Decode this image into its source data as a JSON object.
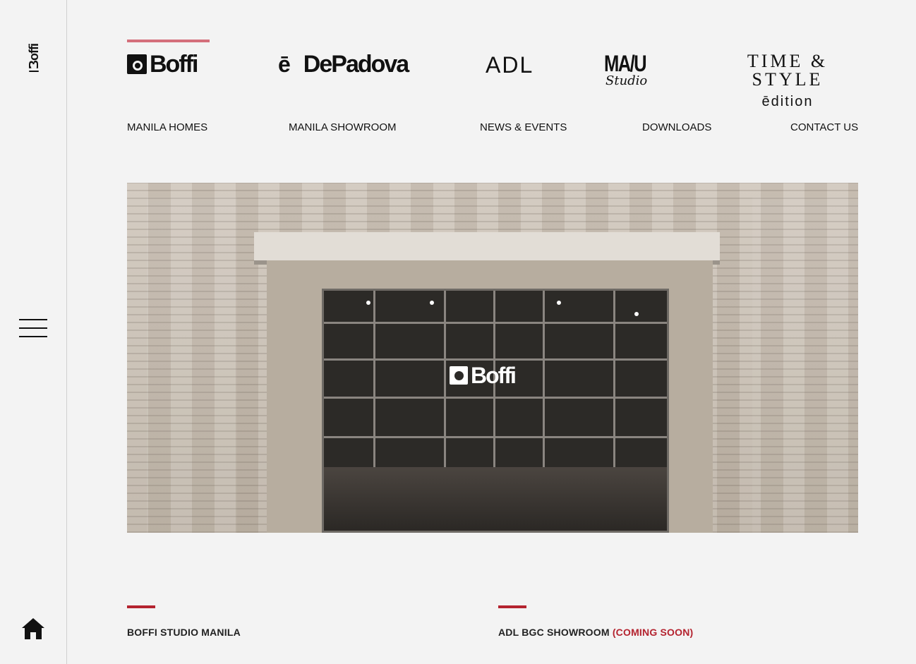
{
  "sidebar": {
    "logo_text": "Boffi",
    "menu_icon": "hamburger-menu-icon",
    "home_icon": "home-icon"
  },
  "brands": [
    {
      "name": "Boffi",
      "active": true
    },
    {
      "name": "DePadova",
      "prefix": "ē"
    },
    {
      "name": "ADL"
    },
    {
      "name": "MA/U",
      "sub": "Studio"
    },
    {
      "name": "TIME & STYLE",
      "sub": "ēdition"
    }
  ],
  "nav": {
    "items": [
      "MANILA HOMES",
      "MANILA SHOWROOM",
      "NEWS & EVENTS",
      "DOWNLOADS",
      "CONTACT US"
    ]
  },
  "hero": {
    "sign_text": "Boffi",
    "door_label": "Boffi"
  },
  "sections": [
    {
      "title": "BOFFI STUDIO MANILA",
      "accent": ""
    },
    {
      "title": "ADL BGC SHOWROOM",
      "accent": "(COMING SOON)"
    }
  ],
  "colors": {
    "accent_red": "#b4232f",
    "active_brand_bar": "#d46f7b",
    "background": "#f3f3f3"
  }
}
